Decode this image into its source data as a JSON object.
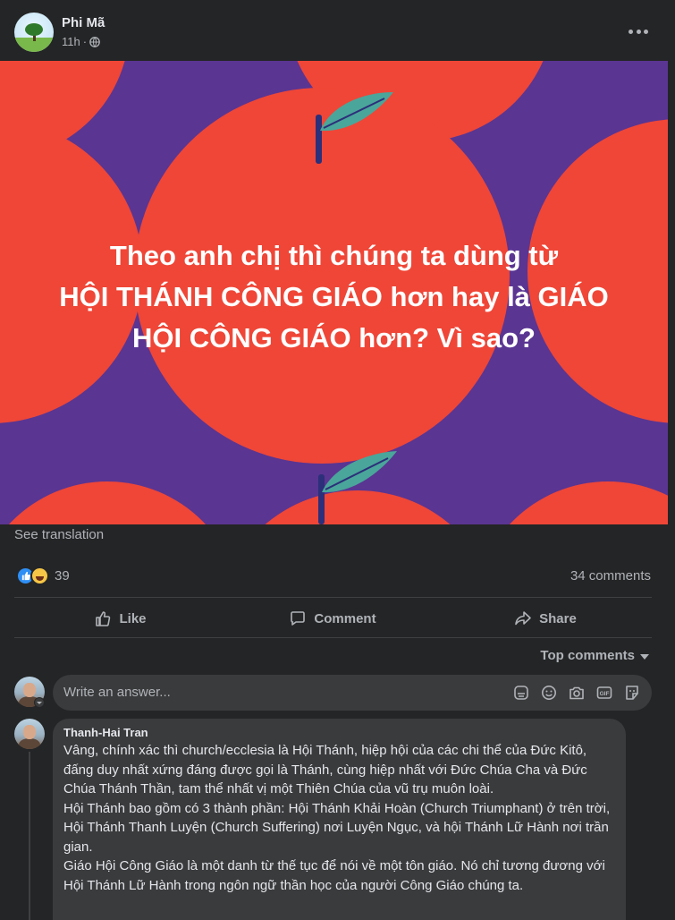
{
  "post": {
    "author": "Phi Mã",
    "time": "11h",
    "time_separator": "·",
    "banner_text_line1": "Theo anh chị thì chúng ta dùng từ",
    "banner_text_line2": "HỘI THÁNH CÔNG GIÁO hơn hay là GIÁO",
    "banner_text_line3": "HỘI CÔNG GIÁO hơn? Vì sao?",
    "see_translation": "See translation"
  },
  "stats": {
    "reaction_count": "39",
    "comments_count": "34 comments"
  },
  "actions": {
    "like": "Like",
    "comment": "Comment",
    "share": "Share"
  },
  "comments": {
    "sort_label": "Top comments",
    "input_placeholder": "Write an answer...",
    "items": [
      {
        "author": "Thanh-Hai Tran",
        "text": "Vâng, chính xác thì church/ecclesia là Hội Thánh, hiệp hội của các chi thể của Đức Kitô, đấng duy nhất xứng đáng được gọi là Thánh, cùng hiệp nhất với Đức Chúa Cha và Đức Chúa Thánh Thần, tam thể nhất vị một Thiên Chúa của vũ trụ muôn loài.\nHội Thánh bao gồm có 3 thành phần: Hội Thánh Khải Hoàn (Church Triumphant) ở trên trời, Hội Thánh Thanh Luyện (Church Suffering) nơi Luyện Ngục, và hội Thánh Lữ Hành nơi trần gian.\nGiáo Hội Công Giáo là một danh từ thế tục để nói về một tôn giáo. Nó chỉ tương đương với Hội Thánh Lữ Hành trong ngôn ngữ thần học của người Công Giáo chúng ta."
      }
    ]
  },
  "colors": {
    "background": "#242526",
    "surface": "#3a3b3c",
    "banner_red": "#ef4637",
    "banner_purple": "#5a3592",
    "leaf": "#4aa69a",
    "like_blue": "#2e8ff5"
  },
  "icons": [
    "more-icon",
    "globe-icon",
    "like-icon",
    "comment-icon",
    "share-icon",
    "sticker-icon",
    "emoji-icon",
    "camera-icon",
    "gif-icon",
    "avatar-sticker-icon"
  ]
}
